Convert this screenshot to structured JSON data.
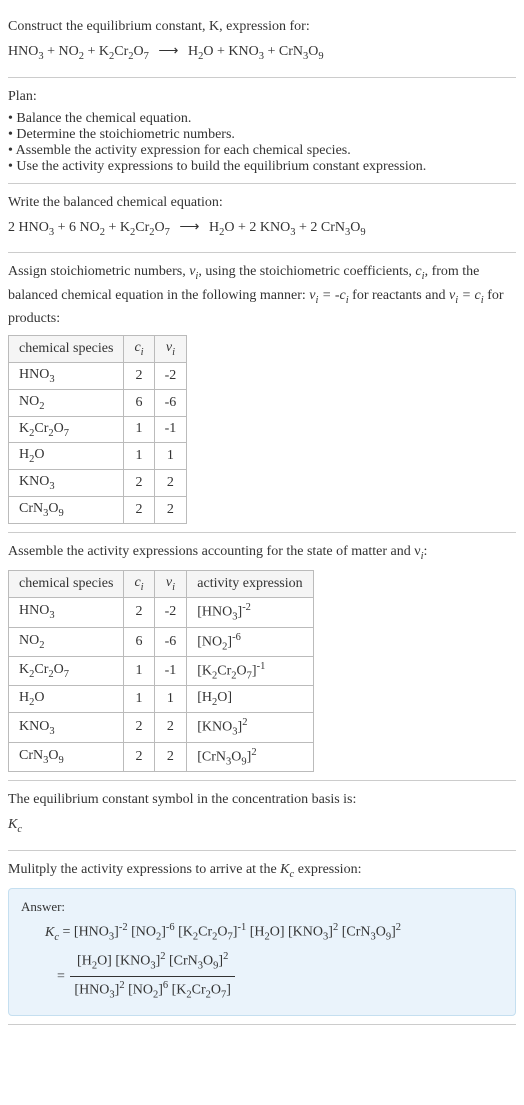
{
  "header": {
    "line1": "Construct the equilibrium constant, K, expression for:",
    "equation_parts": {
      "r1": "HNO",
      "r1sub": "3",
      "r2": "NO",
      "r2sub": "2",
      "r3": "K",
      "r3sub1": "2",
      "r3mid": "Cr",
      "r3sub2": "2",
      "r3end": "O",
      "r3sub3": "7",
      "arrow": "⟶",
      "p1": "H",
      "p1sub": "2",
      "p1end": "O",
      "p2": "KNO",
      "p2sub": "3",
      "p3": "CrN",
      "p3sub1": "3",
      "p3mid": "O",
      "p3sub2": "9"
    }
  },
  "plan": {
    "label": "Plan:",
    "item1": "Balance the chemical equation.",
    "item2": "Determine the stoichiometric numbers.",
    "item3": "Assemble the activity expression for each chemical species.",
    "item4": "Use the activity expressions to build the equilibrium constant expression."
  },
  "balanced": {
    "label": "Write the balanced chemical equation:",
    "c1": "2 ",
    "c2": "6 ",
    "c3": "",
    "c4": "",
    "c5": "2 ",
    "c6": "2 "
  },
  "stoich": {
    "text1": "Assign stoichiometric numbers, ",
    "nu": "ν",
    "nusub": "i",
    "text2": ", using the stoichiometric coefficients, ",
    "c": "c",
    "csub": "i",
    "text3": ", from the balanced chemical equation in the following manner: ",
    "eq1a": "ν",
    "eq1b": "i",
    "eq1c": " = -c",
    "eq1d": "i",
    "text4": " for reactants and ",
    "eq2a": "ν",
    "eq2b": "i",
    "eq2c": " = c",
    "eq2d": "i",
    "text5": " for products:"
  },
  "table1": {
    "h1": "chemical species",
    "h2": "c",
    "h2sub": "i",
    "h3": "ν",
    "h3sub": "i",
    "rows": {
      "r1": {
        "c": "2",
        "nu": "-2"
      },
      "r2": {
        "c": "6",
        "nu": "-6"
      },
      "r3": {
        "c": "1",
        "nu": "-1"
      },
      "r4": {
        "c": "1",
        "nu": "1"
      },
      "r5": {
        "c": "2",
        "nu": "2"
      },
      "r6": {
        "c": "2",
        "nu": "2"
      }
    }
  },
  "activity_label": "Assemble the activity expressions accounting for the state of matter and ν",
  "activity_label_sub": "i",
  "activity_label_end": ":",
  "table2": {
    "h4": "activity expression"
  },
  "kc_symbol": {
    "line1": "The equilibrium constant symbol in the concentration basis is:",
    "symbol": "K",
    "sub": "c"
  },
  "multiply": {
    "text1": "Mulitply the activity expressions to arrive at the ",
    "k": "K",
    "ksub": "c",
    "text2": " expression:"
  },
  "answer": {
    "label": "Answer:"
  }
}
